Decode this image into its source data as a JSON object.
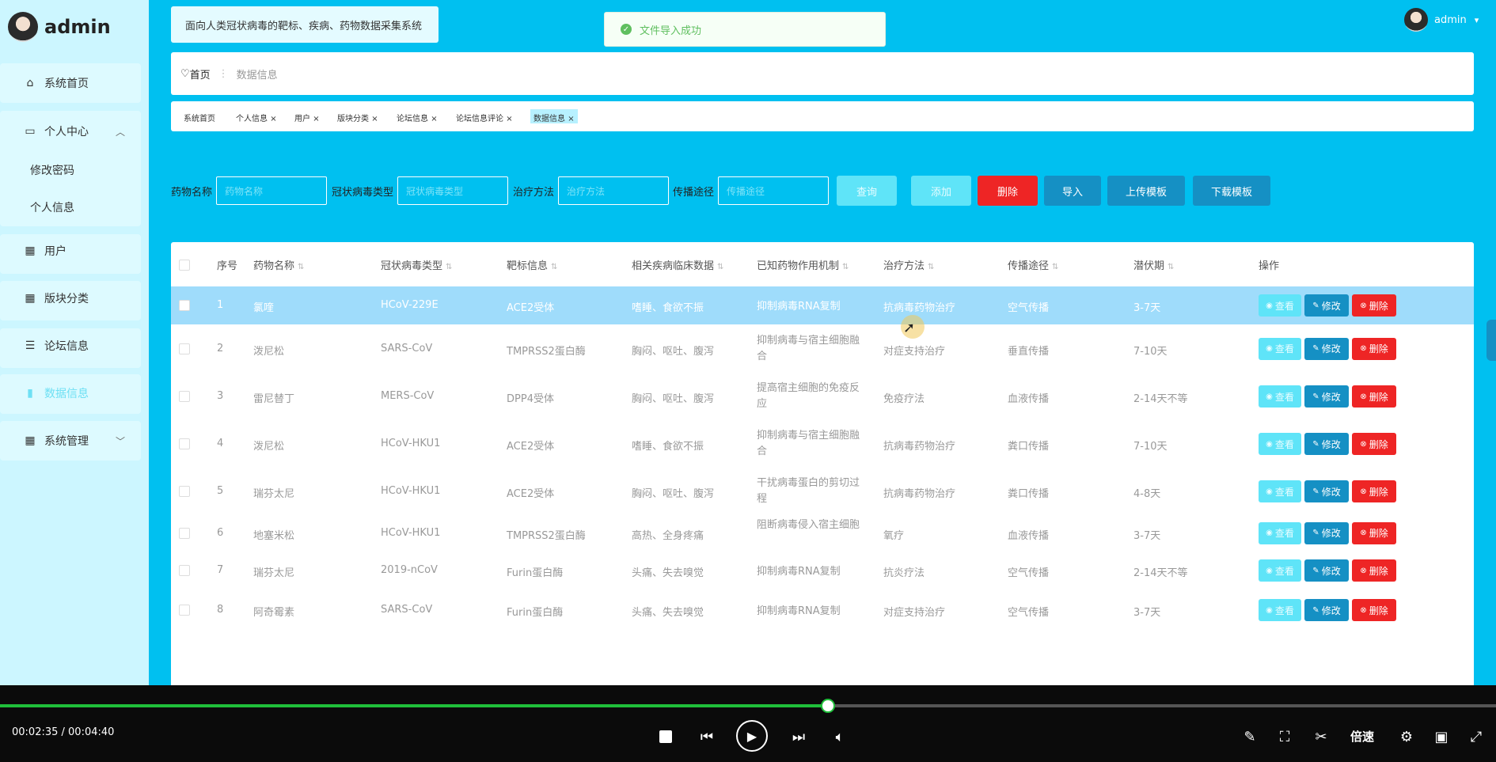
{
  "sidebar": {
    "user": "admin",
    "items": [
      {
        "label": "系统首页",
        "icon": "home-icon"
      },
      {
        "label": "个人中心",
        "icon": "calendar-icon"
      },
      {
        "label": "修改密码"
      },
      {
        "label": "个人信息"
      },
      {
        "label": "用户",
        "icon": "grid-icon"
      },
      {
        "label": "版块分类",
        "icon": "grid-icon"
      },
      {
        "label": "论坛信息",
        "icon": "sliders-icon"
      },
      {
        "label": "数据信息",
        "icon": "chart-icon"
      },
      {
        "label": "系统管理",
        "icon": "grid-icon"
      }
    ]
  },
  "header": {
    "system_title": "面向人类冠状病毒的靶标、疾病、药物数据采集系统",
    "toast": "文件导入成功",
    "user": "admin"
  },
  "breadcrumb": {
    "home": "首页",
    "current": "数据信息"
  },
  "tabs": [
    "系统首页",
    "个人信息",
    "用户",
    "版块分类",
    "论坛信息",
    "论坛信息评论",
    "数据信息"
  ],
  "search": {
    "fields": [
      {
        "label": "药物名称",
        "placeholder": "药物名称"
      },
      {
        "label": "冠状病毒类型",
        "placeholder": "冠状病毒类型"
      },
      {
        "label": "治疗方法",
        "placeholder": "治疗方法"
      },
      {
        "label": "传播途径",
        "placeholder": "传播途径"
      }
    ],
    "buttons": {
      "query": "查询",
      "add": "添加",
      "delete": "删除",
      "import": "导入",
      "upload": "上传模板",
      "download": "下载模板"
    }
  },
  "table": {
    "columns": [
      "序号",
      "药物名称",
      "冠状病毒类型",
      "靶标信息",
      "相关疾病临床数据",
      "已知药物作用机制",
      "治疗方法",
      "传播途径",
      "潜伏期",
      "操作"
    ],
    "actions": {
      "view": "查看",
      "edit": "修改",
      "delete": "删除"
    },
    "rows": [
      [
        "1",
        "氯喹",
        "HCoV-229E",
        "ACE2受体",
        "嗜睡、食欲不振",
        "抑制病毒RNA复制",
        "抗病毒药物治疗",
        "空气传播",
        "3-7天"
      ],
      [
        "2",
        "泼尼松",
        "SARS-CoV",
        "TMPRSS2蛋白酶",
        "胸闷、呕吐、腹泻",
        "抑制病毒与宿主细胞融合",
        "对症支持治疗",
        "垂直传播",
        "7-10天"
      ],
      [
        "3",
        "雷尼替丁",
        "MERS-CoV",
        "DPP4受体",
        "胸闷、呕吐、腹泻",
        "提高宿主细胞的免疫反应",
        "免疫疗法",
        "血液传播",
        "2-14天不等"
      ],
      [
        "4",
        "泼尼松",
        "HCoV-HKU1",
        "ACE2受体",
        "嗜睡、食欲不振",
        "抑制病毒与宿主细胞融合",
        "抗病毒药物治疗",
        "粪口传播",
        "7-10天"
      ],
      [
        "5",
        "瑞芬太尼",
        "HCoV-HKU1",
        "ACE2受体",
        "胸闷、呕吐、腹泻",
        "干扰病毒蛋白的剪切过程",
        "抗病毒药物治疗",
        "粪口传播",
        "4-8天"
      ],
      [
        "6",
        "地塞米松",
        "HCoV-HKU1",
        "TMPRSS2蛋白酶",
        "高热、全身疼痛",
        "阻断病毒侵入宿主细胞",
        "氧疗",
        "血液传播",
        "3-7天"
      ],
      [
        "7",
        "瑞芬太尼",
        "2019-nCoV",
        "Furin蛋白酶",
        "头痛、失去嗅觉",
        "抑制病毒RNA复制",
        "抗炎疗法",
        "空气传播",
        "2-14天不等"
      ],
      [
        "8",
        "阿奇霉素",
        "SARS-CoV",
        "Furin蛋白酶",
        "头痛、失去嗅觉",
        "抑制病毒RNA复制",
        "对症支持治疗",
        "空气传播",
        "3-7天"
      ]
    ]
  },
  "player": {
    "time": "00:02:35 / 00:04:40",
    "progress": 0.5536,
    "speed_label": "倍速"
  }
}
